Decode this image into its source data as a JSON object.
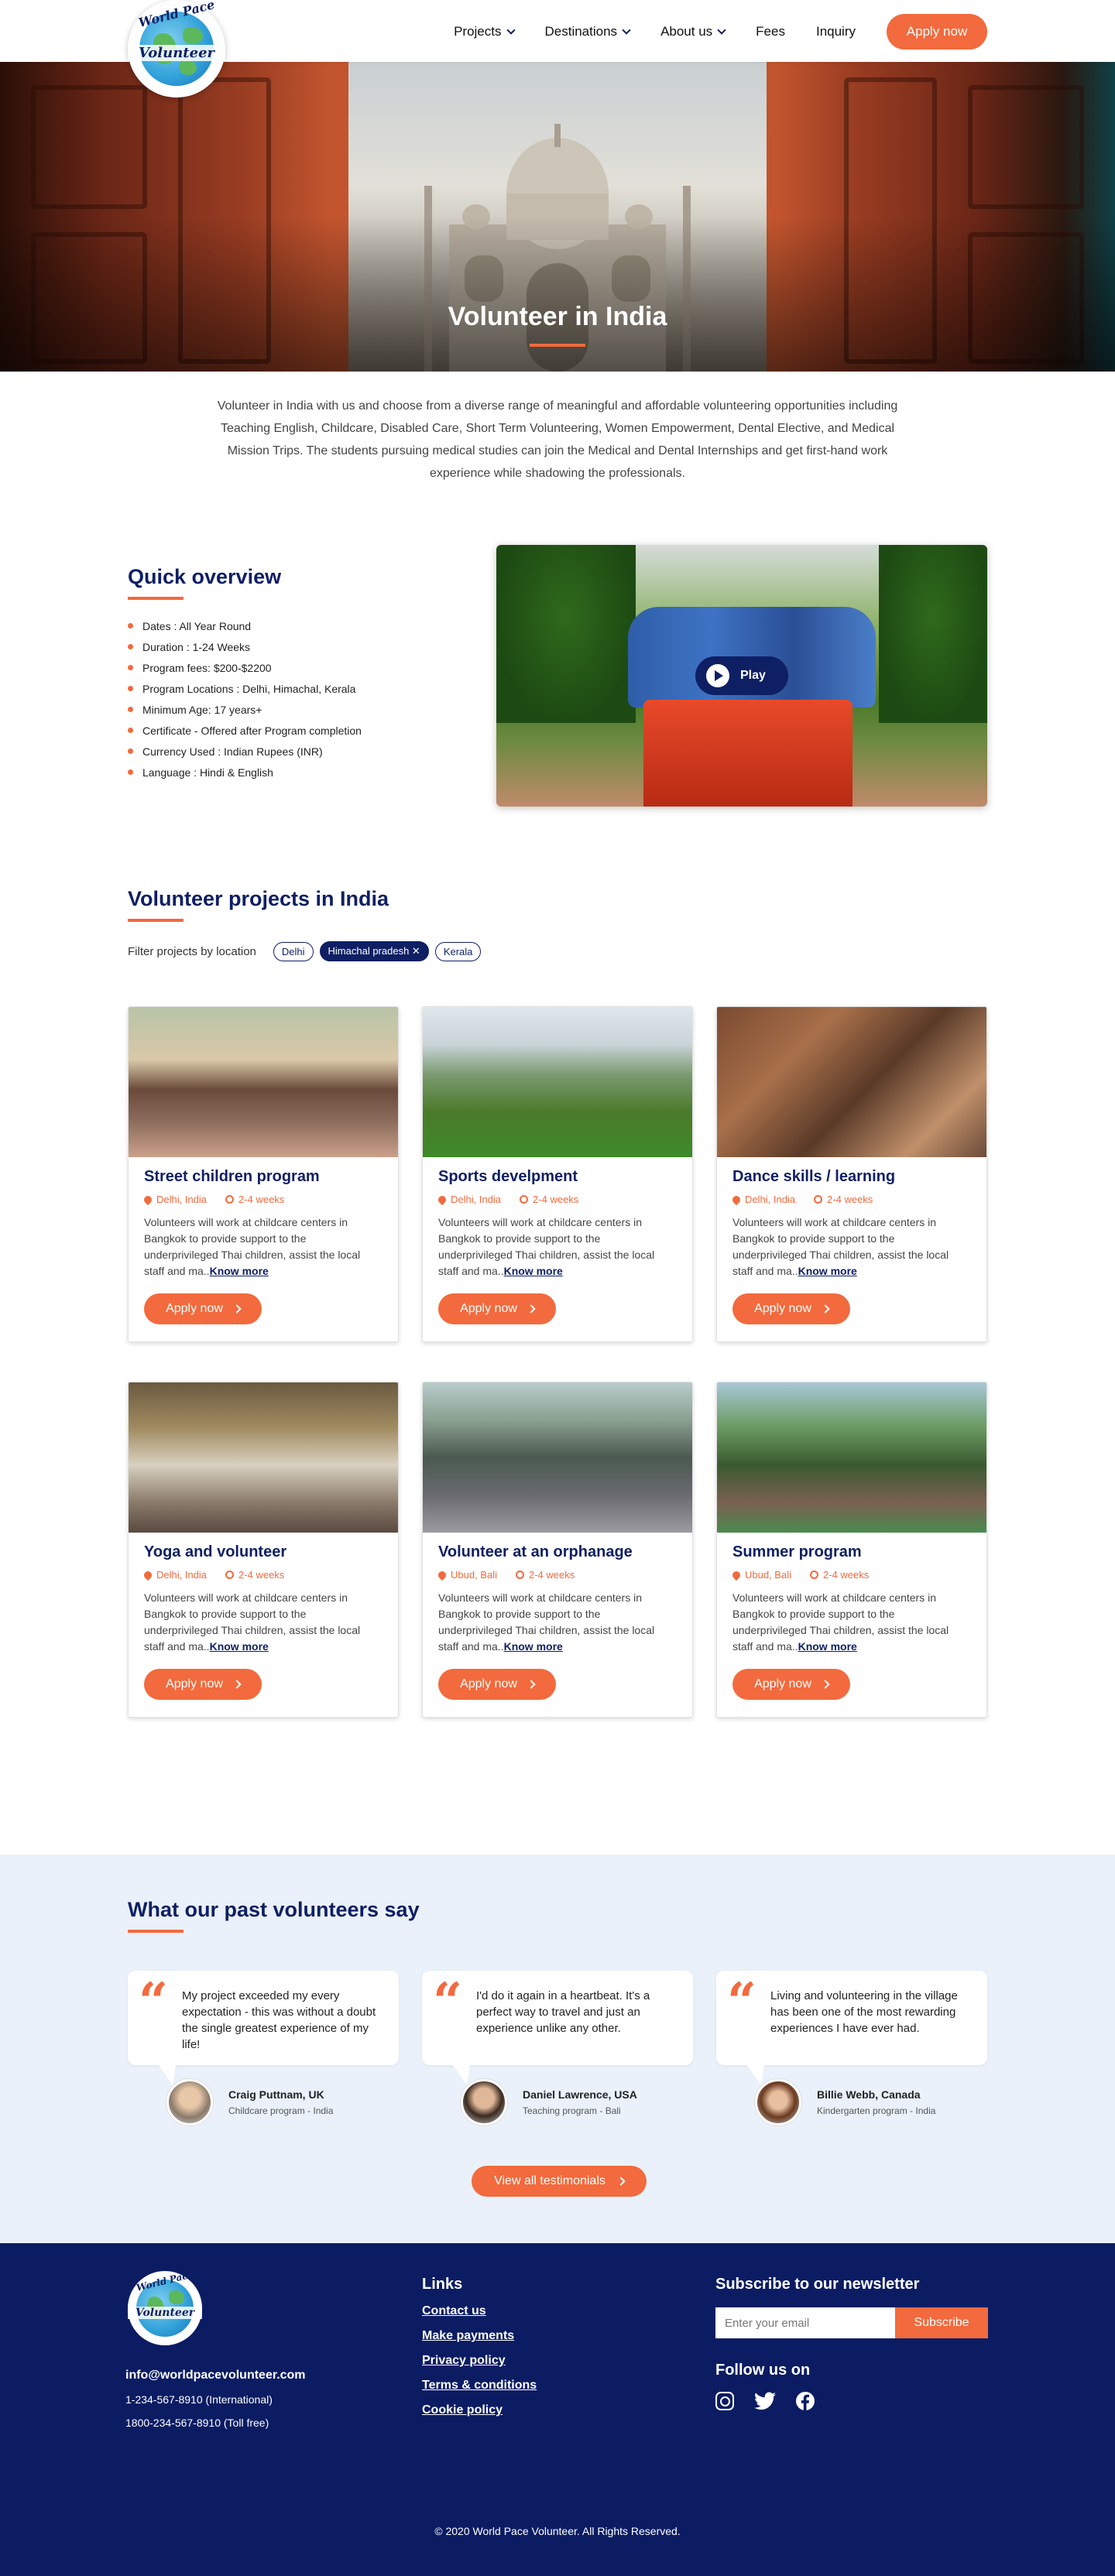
{
  "nav": {
    "logo_top": "World Pace",
    "logo_bottom": "Volunteer",
    "items": [
      {
        "label": "Projects",
        "dropdown": true
      },
      {
        "label": "Destinations",
        "dropdown": true
      },
      {
        "label": "About us",
        "dropdown": true
      },
      {
        "label": "Fees",
        "dropdown": false
      },
      {
        "label": "Inquiry",
        "dropdown": false
      }
    ],
    "apply": "Apply now"
  },
  "hero": {
    "title": "Volunteer in India"
  },
  "intro": "Volunteer in India with us and choose from a diverse range of meaningful and affordable volunteering opportunities including Teaching English, Childcare, Disabled Care, Short Term Volunteering, Women Empowerment, Dental Elective, and Medical Mission Trips. The students pursuing medical studies can join the Medical and Dental Internships and get first-hand work experience while shadowing the professionals.",
  "overview": {
    "title": "Quick overview",
    "items": [
      "Dates : All Year Round",
      "Duration : 1-24 Weeks",
      "Program fees: $200-$2200",
      "Program Locations : Delhi, Himachal, Kerala",
      "Minimum Age: 17 years+",
      "Certificate - Offered after Program completion",
      "Currency Used : Indian Rupees (INR)",
      "Language : Hindi & English"
    ],
    "play": "Play"
  },
  "projects": {
    "title": "Volunteer projects in India",
    "filter_label": "Filter projects by location",
    "chips": [
      {
        "label": "Delhi",
        "active": false
      },
      {
        "label": "Himachal pradesh ✕",
        "active": true
      },
      {
        "label": "Kerala",
        "active": false
      }
    ],
    "know_more": "Know more",
    "apply": "Apply now",
    "cards": [
      {
        "title": "Street children program",
        "location": "Delhi, India",
        "duration": "2-4 weeks",
        "desc": "Volunteers will work at childcare centers in Bangkok to provide support to the underprivileged Thai children, assist the local staff and ma.."
      },
      {
        "title": "Sports develpment",
        "location": "Delhi, India",
        "duration": "2-4 weeks",
        "desc": "Volunteers will work at childcare centers in Bangkok to provide support to the underprivileged Thai children, assist the local staff and ma.."
      },
      {
        "title": "Dance skills / learning",
        "location": "Delhi, India",
        "duration": "2-4 weeks",
        "desc": "Volunteers will work at childcare centers in Bangkok to provide support to the underprivileged Thai children, assist the local staff and ma.."
      },
      {
        "title": "Yoga and volunteer",
        "location": "Delhi, India",
        "duration": "2-4 weeks",
        "desc": "Volunteers will work at childcare centers in Bangkok to provide support to the underprivileged Thai children, assist the local staff and ma.."
      },
      {
        "title": "Volunteer at an orphanage",
        "location": "Ubud, Bali",
        "duration": "2-4 weeks",
        "desc": "Volunteers will work at childcare centers in Bangkok to provide support to the underprivileged Thai children, assist the local staff and ma.."
      },
      {
        "title": "Summer program",
        "location": "Ubud, Bali",
        "duration": "2-4 weeks",
        "desc": "Volunteers will work at childcare centers in Bangkok to provide support to the underprivileged Thai children, assist the local staff and ma.."
      }
    ]
  },
  "testimonials": {
    "title": "What our past volunteers say",
    "items": [
      {
        "quote": "My project exceeded my every expectation - this was without a doubt the single greatest experience of my life!",
        "name": "Craig Puttnam, UK",
        "role": "Childcare program - India"
      },
      {
        "quote": "I'd do it again in a heartbeat. It's a perfect way to travel and just an experience unlike any other.",
        "name": "Daniel Lawrence, USA",
        "role": "Teaching program - Bali"
      },
      {
        "quote": "Living and volunteering in the village has been one of the most rewarding experiences I have ever had.",
        "name": "Billie Webb, Canada",
        "role": "Kindergarten program - India"
      }
    ],
    "view_all": "View all testimonials"
  },
  "footer": {
    "email": "info@worldpacevolunteer.com",
    "phone_intl": "1-234-567-8910 (International)",
    "phone_free": "1800-234-567-8910 (Toll free)",
    "links_title": "Links",
    "links": [
      "Contact us",
      "Make payments",
      "Privacy policy",
      "Terms & conditions",
      "Cookie policy"
    ],
    "newsletter_title": "Subscribe to our newsletter",
    "email_placeholder": "Enter your email",
    "subscribe": "Subscribe",
    "follow_title": "Follow us on",
    "social": [
      "instagram-icon",
      "twitter-icon",
      "facebook-icon"
    ],
    "copyright": "© 2020 World Pace Volunteer. All Rights Reserved."
  },
  "colors": {
    "navy": "#0f1f64",
    "orange": "#f26a3d",
    "footer": "#0b1c63",
    "testimonial_bg": "#eaf1fa"
  }
}
